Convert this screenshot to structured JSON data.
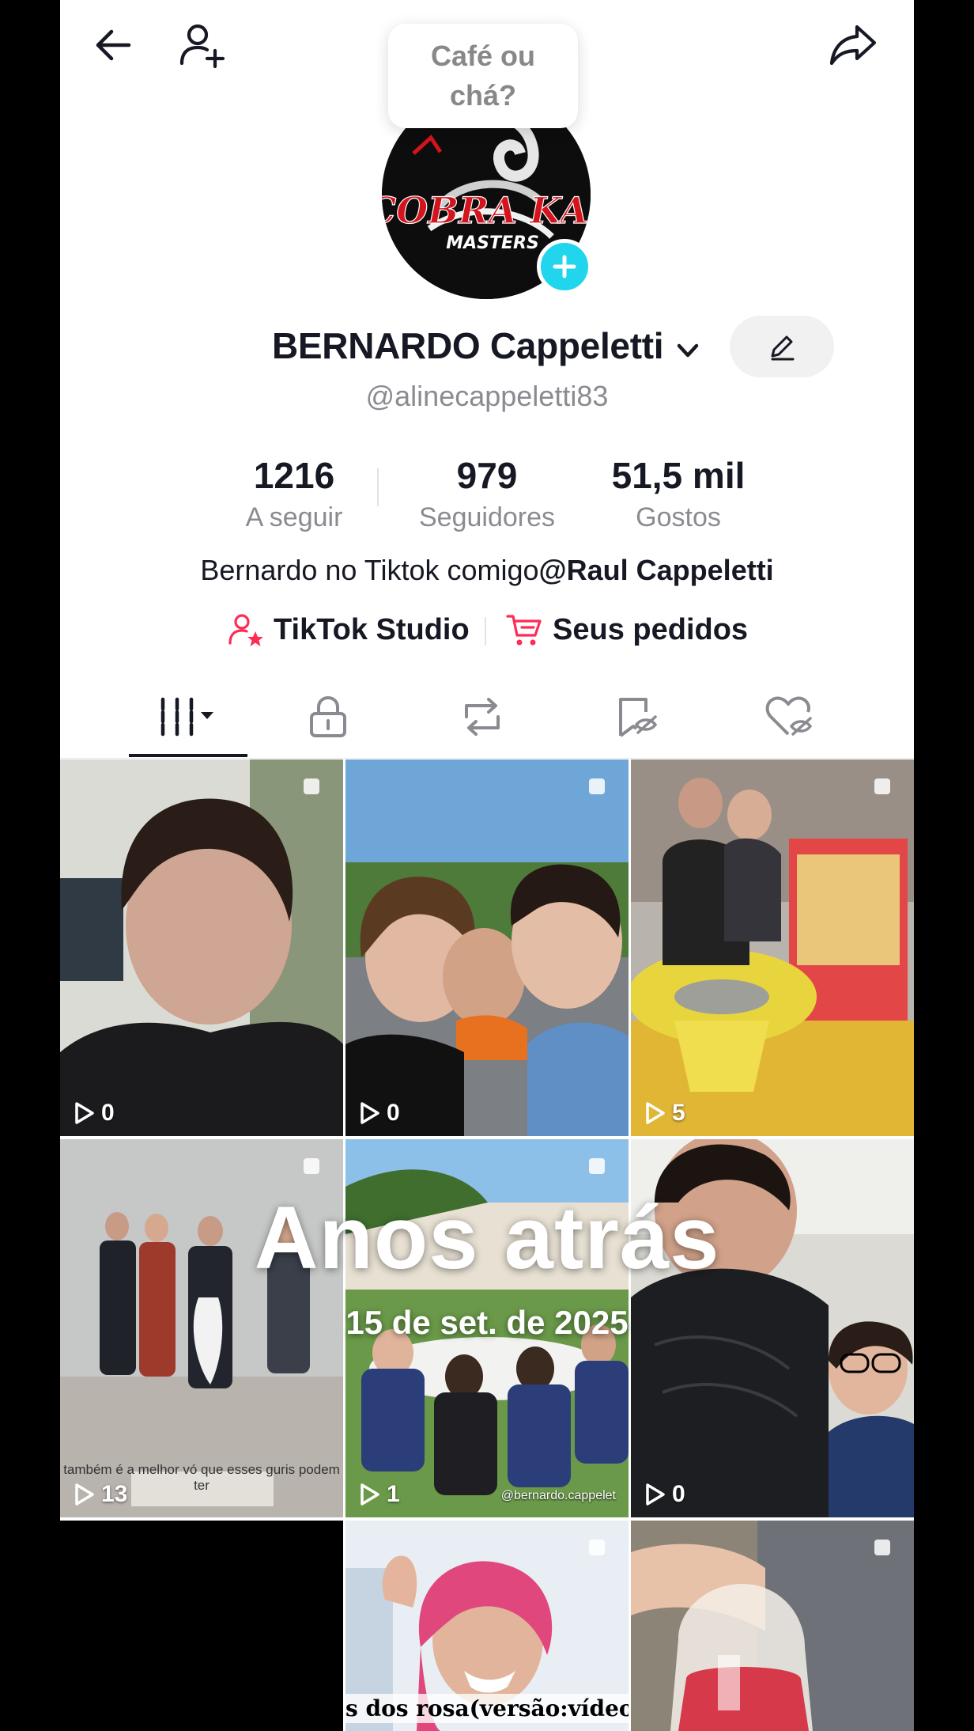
{
  "header": {
    "bubble_text": "Café ou\nchá?"
  },
  "profile": {
    "name": "BERNARDO Cappeletti",
    "handle": "@alinecappeletti83",
    "avatar_text": "COBRA KAI",
    "avatar_subtext": "MASTERS"
  },
  "stats": [
    {
      "value": "1216",
      "label": "A seguir"
    },
    {
      "value": "979",
      "label": "Seguidores"
    },
    {
      "value": "51,5 mil",
      "label": "Gostos"
    }
  ],
  "bio": {
    "text": "Bernardo no Tiktok comigo",
    "mention": "@Raul Cappeletti"
  },
  "links": {
    "studio": "TikTok Studio",
    "orders": "Seus pedidos"
  },
  "videos": [
    {
      "views": "0"
    },
    {
      "views": "0"
    },
    {
      "views": "5"
    },
    {
      "views": "13",
      "caption": "também é a melhor vó que esses guris podem ter"
    },
    {
      "views": "1",
      "watermark": "@bernardo.cappelet"
    },
    {
      "views": "0"
    },
    {},
    {
      "caption": "s dos rosa(versão:vídeo"
    },
    {}
  ],
  "memory": {
    "title": "Anos atrás",
    "date": "15 de set. de 2025"
  },
  "colors": {
    "accent_pink": "#fe2c55",
    "accent_cyan": "#20d5ec",
    "text_primary": "#161823",
    "text_secondary": "#8a8b91"
  }
}
